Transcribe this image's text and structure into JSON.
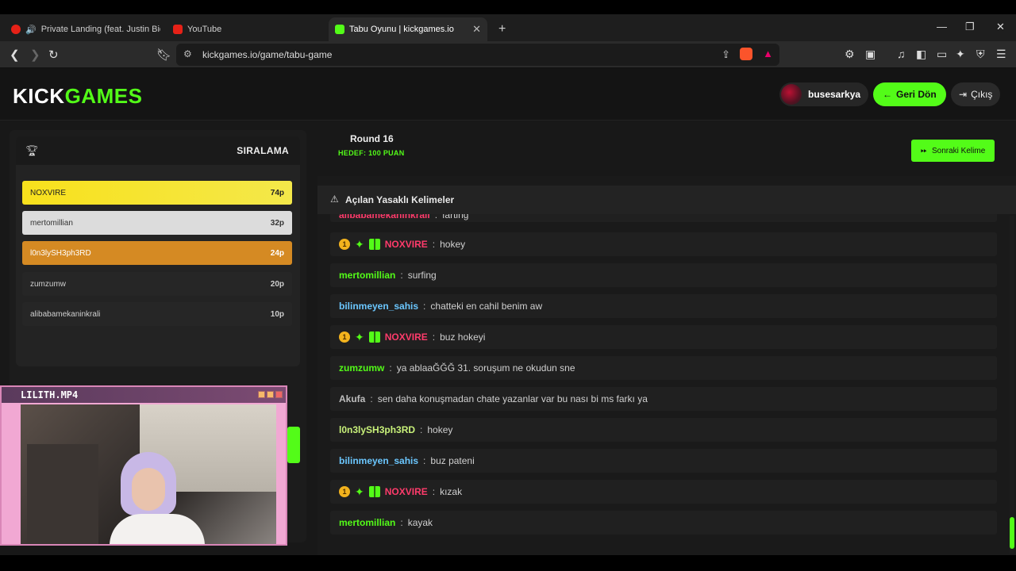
{
  "browser": {
    "tabs": [
      {
        "label": "Private Landing (feat. Justin Biebe",
        "active": false
      },
      {
        "label": "YouTube",
        "active": false
      },
      {
        "label": "Tabu Oyunu | kickgames.io",
        "active": true
      }
    ],
    "new_tab": "+",
    "url": "kickgames.io/game/tabu-game"
  },
  "header": {
    "logo_part1": "KICK",
    "logo_part2": "GAMES",
    "username": "busesarkya",
    "back_label": "Geri Dön",
    "logout_label": "Çıkış"
  },
  "ranking": {
    "title": "SIRALAMA",
    "rows": [
      {
        "name": "NOXVIRE",
        "points": "74p"
      },
      {
        "name": "mertomillian",
        "points": "32p"
      },
      {
        "name": "l0n3lySH3ph3RD",
        "points": "24p"
      },
      {
        "name": "zumzumw",
        "points": "20p"
      },
      {
        "name": "alibabamekaninkrali",
        "points": "10p"
      }
    ]
  },
  "webcam": {
    "title": "LILITH.MP4"
  },
  "game": {
    "round": "Round 16",
    "target": "HEDEF: 100 PUAN",
    "next_label": "Sonraki Kelime",
    "banned_title": "Açılan Yasaklı Kelimeler"
  },
  "chat": [
    {
      "name": "NOXVIRE",
      "text": "hokey",
      "badges": true,
      "color": "#ff3b6b"
    },
    {
      "name": "mertomillian",
      "text": "surfing",
      "badges": false,
      "color": "#53fc18"
    },
    {
      "name": "bilinmeyen_sahis",
      "text": "chatteki en cahil benim aw",
      "badges": false,
      "color": "#6bc7ff"
    },
    {
      "name": "NOXVIRE",
      "text": "buz hokeyi",
      "badges": true,
      "color": "#ff3b6b"
    },
    {
      "name": "zumzumw",
      "text": "ya ablaaĞĞĞ 31. soruşum ne okudun sne",
      "badges": false,
      "color": "#53fc18"
    },
    {
      "name": "Akufa",
      "text": "sen daha konuşmadan chate yazanlar var bu nası bi ms farkı ya",
      "badges": false,
      "color": "#bdbdbd"
    },
    {
      "name": "l0n3lySH3ph3RD",
      "text": "hokey",
      "badges": false,
      "color": "#c9f27a"
    },
    {
      "name": "bilinmeyen_sahis",
      "text": "buz pateni",
      "badges": false,
      "color": "#6bc7ff"
    },
    {
      "name": "NOXVIRE",
      "text": "kızak",
      "badges": true,
      "color": "#ff3b6b"
    },
    {
      "name": "mertomillian",
      "text": "kayak",
      "badges": false,
      "color": "#53fc18"
    }
  ],
  "chat_partial": {
    "name": "alibabamekaninkrali",
    "text": "farting"
  },
  "badge_number": "1",
  "colors": {
    "accent": "#53fc18",
    "gold": "#f8e11c",
    "silver": "#dcdcdc",
    "bronze": "#d58a23"
  }
}
